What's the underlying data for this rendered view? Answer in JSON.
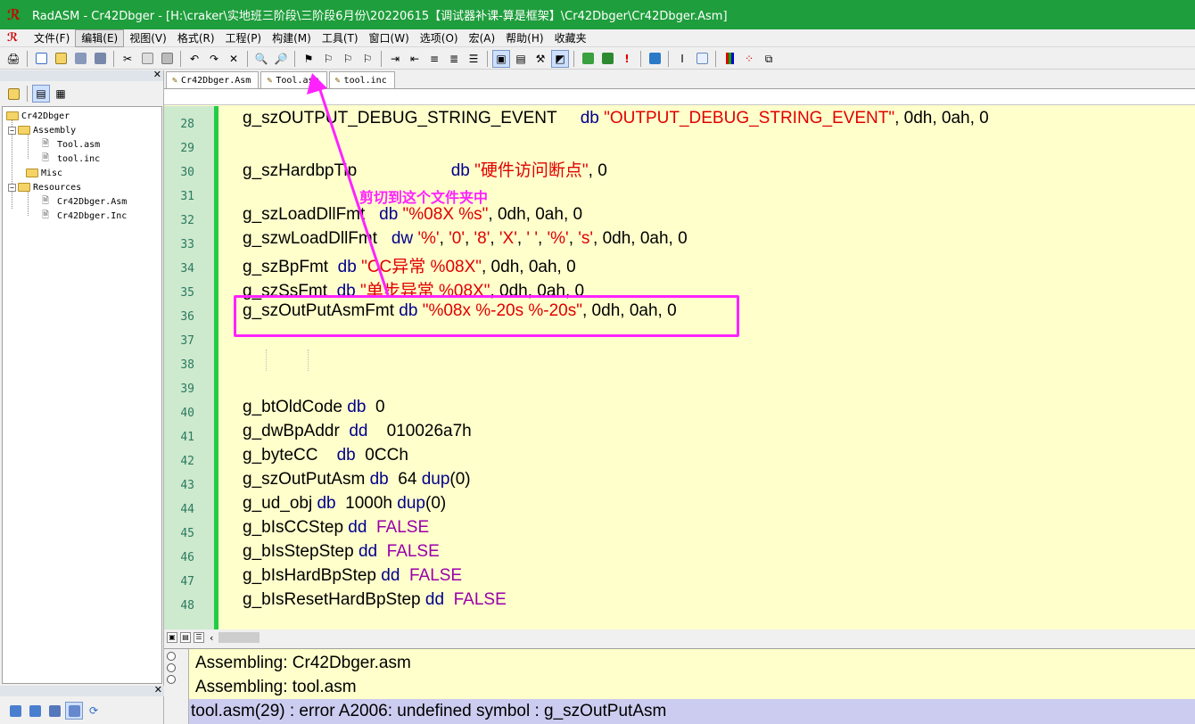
{
  "window": {
    "title": "RadASM - Cr42Dbger - [H:\\craker\\实地班三阶段\\三阶段6月份\\20220615【调试器补课-算是框架】\\Cr42Dbger\\Cr42Dbger.Asm]"
  },
  "menu": [
    "文件(F)",
    "编辑(E)",
    "视图(V)",
    "格式(R)",
    "工程(P)",
    "构建(M)",
    "工具(T)",
    "窗口(W)",
    "选项(O)",
    "宏(A)",
    "帮助(H)",
    "收藏夹"
  ],
  "tabs": [
    {
      "label": "Cr42Dbger.Asm",
      "icon": "asm-file-icon"
    },
    {
      "label": "Tool.asm",
      "icon": "asm-file-icon"
    },
    {
      "label": "tool.inc",
      "icon": "inc-file-icon"
    }
  ],
  "tree": {
    "root": "Cr42Dbger",
    "assembly": "Assembly",
    "assembly_files": [
      "Tool.asm",
      "tool.inc"
    ],
    "misc": "Misc",
    "resources": "Resources",
    "resource_files": [
      "Cr42Dbger.Asm",
      "Cr42Dbger.Inc"
    ]
  },
  "editor": {
    "lines": [
      {
        "n": "28",
        "name": "g_szOUTPUT_DEBUG_STRING_EVENT",
        "gap": "     ",
        "kw": "db",
        "rest": [
          [
            "str",
            "\"OUTPUT_DEBUG_STRING_EVENT\""
          ],
          [
            "tok",
            ", 0dh, 0ah, 0"
          ]
        ]
      },
      {
        "n": "29",
        "name": "",
        "gap": "",
        "kw": "",
        "rest": []
      },
      {
        "n": "30",
        "name": "g_szHardbpTip",
        "gap": "                    ",
        "kw": "db",
        "rest": [
          [
            "str",
            "\"硬件访问断点\""
          ],
          [
            "tok",
            ", 0"
          ]
        ]
      },
      {
        "n": "31",
        "name": "",
        "gap": "",
        "kw": "",
        "rest": []
      },
      {
        "n": "32",
        "name": "g_szLoadDllFmt",
        "gap": "   ",
        "kw": "db",
        "rest": [
          [
            "str",
            "\"%08X %s\""
          ],
          [
            "tok",
            ", 0dh, 0ah, 0"
          ]
        ]
      },
      {
        "n": "33",
        "name": "g_szwLoadDllFmt",
        "gap": "   ",
        "kw": "dw",
        "rest": [
          [
            "str",
            "'%'"
          ],
          [
            "tok",
            ", "
          ],
          [
            "str",
            "'0'"
          ],
          [
            "tok",
            ", "
          ],
          [
            "str",
            "'8'"
          ],
          [
            "tok",
            ", "
          ],
          [
            "str",
            "'X'"
          ],
          [
            "tok",
            ", "
          ],
          [
            "str",
            "' '"
          ],
          [
            "tok",
            ", "
          ],
          [
            "str",
            "'%'"
          ],
          [
            "tok",
            ", "
          ],
          [
            "str",
            "'s'"
          ],
          [
            "tok",
            ", 0dh, 0ah, 0"
          ]
        ]
      },
      {
        "n": "34",
        "name": "g_szBpFmt",
        "gap": "  ",
        "kw": "db",
        "rest": [
          [
            "str",
            "\"CC异常 %08X\""
          ],
          [
            "tok",
            ", 0dh, 0ah, 0"
          ]
        ]
      },
      {
        "n": "35",
        "name": "g_szSsFmt",
        "gap": "  ",
        "kw": "db",
        "rest": [
          [
            "str",
            "\"单步异常 %08X\""
          ],
          [
            "tok",
            ", 0dh, 0ah, 0"
          ]
        ]
      },
      {
        "n": "36",
        "name": "g_szOutPutAsmFmt",
        "gap": " ",
        "kw": "db",
        "rest": [
          [
            "str",
            "\"%08x %-20s %-20s\""
          ],
          [
            "tok",
            ", 0dh, 0ah, 0"
          ]
        ]
      },
      {
        "n": "37",
        "name": "",
        "gap": "",
        "kw": "",
        "rest": []
      },
      {
        "n": "38",
        "name": "",
        "gap": "",
        "kw": "",
        "rest": []
      },
      {
        "n": "39",
        "name": "",
        "gap": "",
        "kw": "",
        "rest": []
      },
      {
        "n": "40",
        "name": "g_btOldCode",
        "gap": " ",
        "kw": "db",
        "rest": [
          [
            "tok",
            " 0"
          ]
        ]
      },
      {
        "n": "41",
        "name": "g_dwBpAddr",
        "gap": "  ",
        "kw": "dd",
        "rest": [
          [
            "tok",
            "   010026a7h"
          ]
        ]
      },
      {
        "n": "42",
        "name": "g_byteCC",
        "gap": "    ",
        "kw": "db",
        "rest": [
          [
            "tok",
            " 0CCh"
          ]
        ]
      },
      {
        "n": "43",
        "name": "g_szOutPutAsm",
        "gap": " ",
        "kw": "db",
        "rest": [
          [
            "tok",
            " 64 "
          ],
          [
            "kw",
            "dup"
          ],
          [
            "tok",
            "(0)"
          ]
        ]
      },
      {
        "n": "44",
        "name": "g_ud_obj",
        "gap": " ",
        "kw": "db",
        "rest": [
          [
            "tok",
            " 1000h "
          ],
          [
            "kw",
            "dup"
          ],
          [
            "tok",
            "(0)"
          ]
        ]
      },
      {
        "n": "45",
        "name": "g_bIsCCStep",
        "gap": " ",
        "kw": "dd",
        "rest": [
          [
            "cnst",
            " FALSE"
          ]
        ]
      },
      {
        "n": "46",
        "name": "g_bIsStepStep",
        "gap": " ",
        "kw": "dd",
        "rest": [
          [
            "cnst",
            " FALSE"
          ]
        ]
      },
      {
        "n": "47",
        "name": "g_bIsHardBpStep",
        "gap": " ",
        "kw": "dd",
        "rest": [
          [
            "cnst",
            " FALSE"
          ]
        ]
      },
      {
        "n": "48",
        "name": "g_bIsResetHardBpStep",
        "gap": " ",
        "kw": "dd",
        "rest": [
          [
            "cnst",
            " FALSE"
          ]
        ]
      }
    ]
  },
  "output": {
    "lines": [
      "Assembling: Cr42Dbger.asm",
      "Assembling: tool.asm"
    ],
    "error": "tool.asm(29) : error A2006: undefined symbol : g_szOutPutAsm"
  },
  "annotation": {
    "text": "剪切到这个文件夹中",
    "color": "#ff22ff"
  },
  "colors": {
    "titlebar": "#1e9e3c",
    "editor_bg": "#ffffcc",
    "keyword": "#00008b",
    "string": "#e00000",
    "constant": "#9900aa",
    "gutter": "#cde9ce"
  }
}
